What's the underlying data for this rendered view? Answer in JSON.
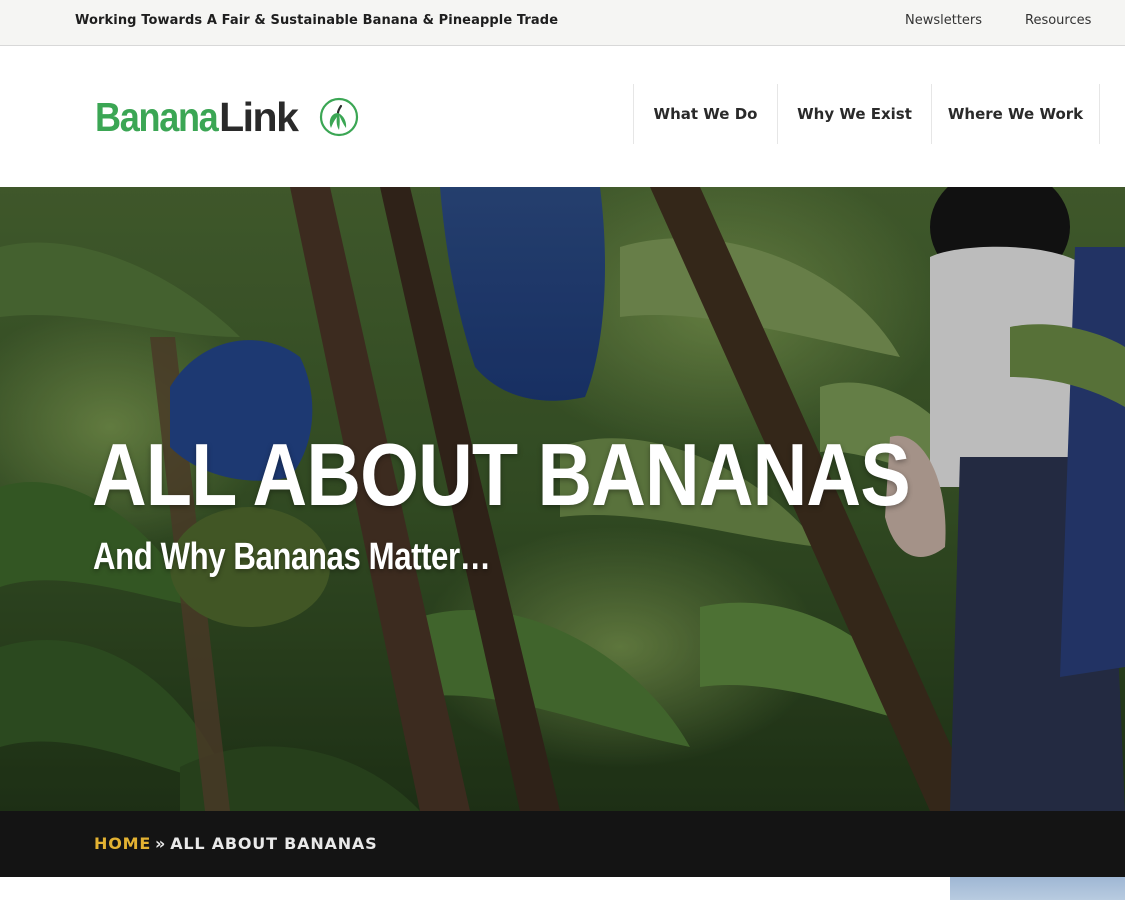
{
  "topbar": {
    "tagline": "Working Towards A Fair & Sustainable Banana & Pineapple Trade",
    "links": [
      "Newsletters",
      "Resources"
    ]
  },
  "header": {
    "logo": {
      "part1": "Banana",
      "part2": "Link",
      "icon": "banana-circle-icon"
    },
    "nav": [
      "What We Do",
      "Why We Exist",
      "Where We Work"
    ]
  },
  "hero": {
    "title": "ALL ABOUT BANANAS",
    "subtitle": "And Why Bananas Matter…"
  },
  "breadcrumb": {
    "home": "HOME",
    "separator": "»",
    "current": "ALL ABOUT BANANAS"
  },
  "colors": {
    "brand_green": "#3ba654",
    "breadcrumb_home": "#e3b232",
    "breadcrumb_bar": "#141414"
  }
}
